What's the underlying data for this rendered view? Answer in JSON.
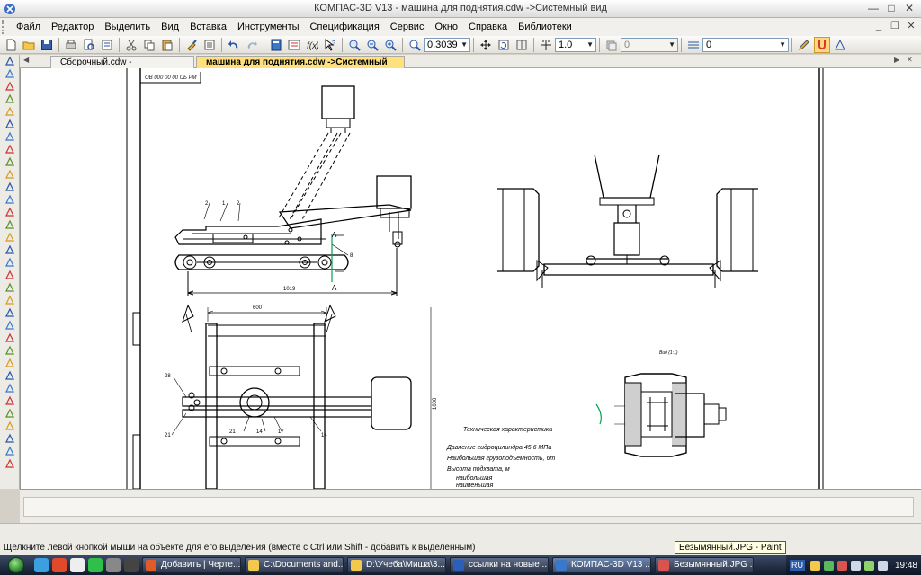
{
  "window": {
    "title": "КОМПАС-3D V13 - машина для поднятия.cdw ->Системный вид"
  },
  "menu": [
    "Файл",
    "Редактор",
    "Выделить",
    "Вид",
    "Вставка",
    "Инструменты",
    "Спецификация",
    "Сервис",
    "Окно",
    "Справка",
    "Библиотеки"
  ],
  "toolbar": {
    "zoom_value": "0.3039",
    "step_value": "1.0",
    "layer_value": "0",
    "style_value": "0"
  },
  "tabs": [
    {
      "label": "Сборочный.cdw ->Системный вид",
      "active": false
    },
    {
      "label": "машина для поднятия.cdw ->Системный вид",
      "active": true
    }
  ],
  "drawing": {
    "stamp": "ОВ 000 00 00 СБ РМ",
    "dim_length": "1019",
    "dim_width": "600",
    "dim_height": "1000",
    "section_label": "A",
    "view_label": "Вид (1:1)",
    "callouts": [
      "2",
      "1",
      "2",
      "8",
      "28",
      "21",
      "21",
      "14",
      "17",
      "14"
    ],
    "tech_title": "Техническая характеристика",
    "tech_lines": [
      "Давление гидроцилиндра 45,6 МПа",
      "Наибольшая грузоподъемность, 6т",
      "Высота подхвата, м",
      "наибольшая",
      "наименьшая"
    ]
  },
  "status": {
    "message": "Щелкните левой кнопкой мыши на объекте для его выделения (вместе с Ctrl или Shift - добавить к выделенным)",
    "tooltip": "Безымянный.JPG - Paint"
  },
  "taskbar": {
    "tasks": [
      {
        "label": "Добавить | Черте...",
        "color": "#e05a2a",
        "active": false
      },
      {
        "label": "C:\\Documents and...",
        "color": "#f2c94c",
        "active": false
      },
      {
        "label": "D:\\Учеба\\Миша\\3...",
        "color": "#f2c94c",
        "active": false
      },
      {
        "label": "ссылки на новые ...",
        "color": "#2b5fb8",
        "active": false
      },
      {
        "label": "КОМПАС-3D V13 ...",
        "color": "#3a78c9",
        "active": true
      },
      {
        "label": "Безымянный.JPG ...",
        "color": "#d9534f",
        "active": false
      }
    ],
    "language": "RU",
    "clock": "19:48"
  }
}
